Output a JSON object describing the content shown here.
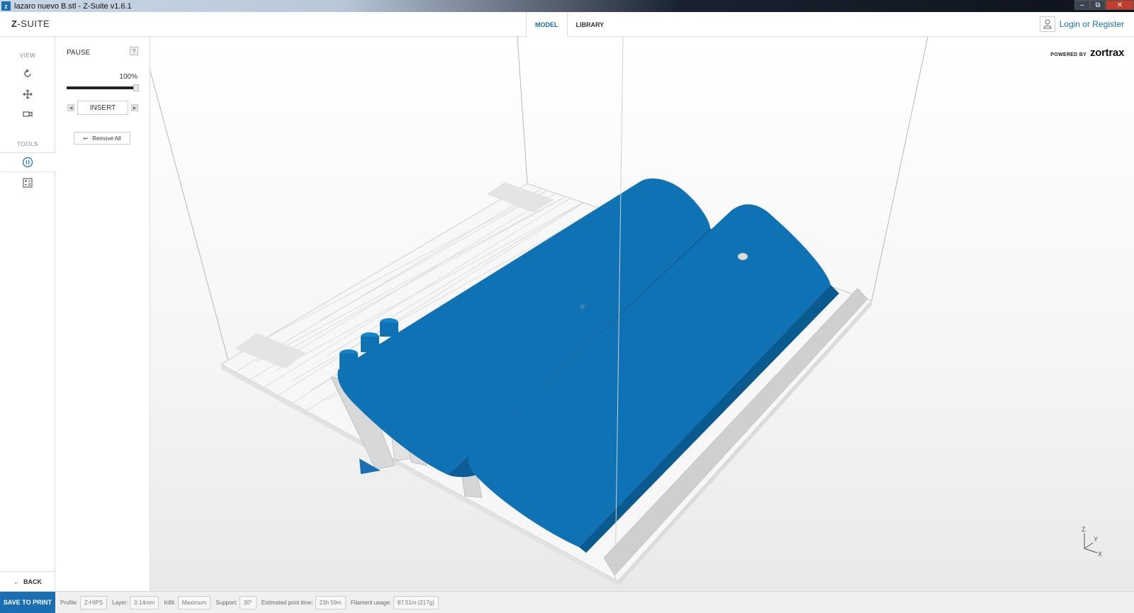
{
  "window": {
    "title": "lazaro nuevo B.stl - Z-Suite v1.6.1",
    "icon_letter": "z",
    "controls": [
      "minimize-icon",
      "restore-icon",
      "close-icon"
    ]
  },
  "header": {
    "logo_strong": "Z",
    "logo_rest": "-SUITE",
    "tabs": [
      {
        "label": "MODEL",
        "active": true
      },
      {
        "label": "LIBRARY",
        "active": false
      }
    ],
    "login_text": "Login or Register"
  },
  "sidebar": {
    "view_label": "VIEW",
    "view_tools": [
      "rotate-icon",
      "pan-icon",
      "camera-icon"
    ],
    "tools_label": "TOOLS",
    "tools": [
      {
        "icon": "pause-icon",
        "active": true
      },
      {
        "icon": "layer-settings-icon",
        "active": false
      }
    ],
    "back_label": "BACK"
  },
  "panel": {
    "title": "PAUSE",
    "help": "?",
    "percent": "100%",
    "slider_value": 1.0,
    "insert_label": "INSERT",
    "remove_all_label": "Remove All"
  },
  "viewport": {
    "powered_by": "POWERED BY",
    "brand": "zortrax",
    "axes": {
      "z": "Z",
      "y": "Y",
      "x": "X"
    },
    "model_color": "#0f72b4"
  },
  "bottom": {
    "save_label": "SAVE TO PRINT",
    "stats": [
      {
        "label": "Profile:",
        "value": "Z-HIPS"
      },
      {
        "label": "Layer:",
        "value": "0.14mm"
      },
      {
        "label": "Infill:",
        "value": "Maximum"
      },
      {
        "label": "Support:",
        "value": "30°"
      },
      {
        "label": "Estimated print time:",
        "value": "23h 59m"
      },
      {
        "label": "Filament usage:",
        "value": "87.51m (217g)"
      }
    ]
  },
  "colors": {
    "accent": "#1a6fb3",
    "model": "#0f72b4",
    "support": "#d0d0d0"
  }
}
